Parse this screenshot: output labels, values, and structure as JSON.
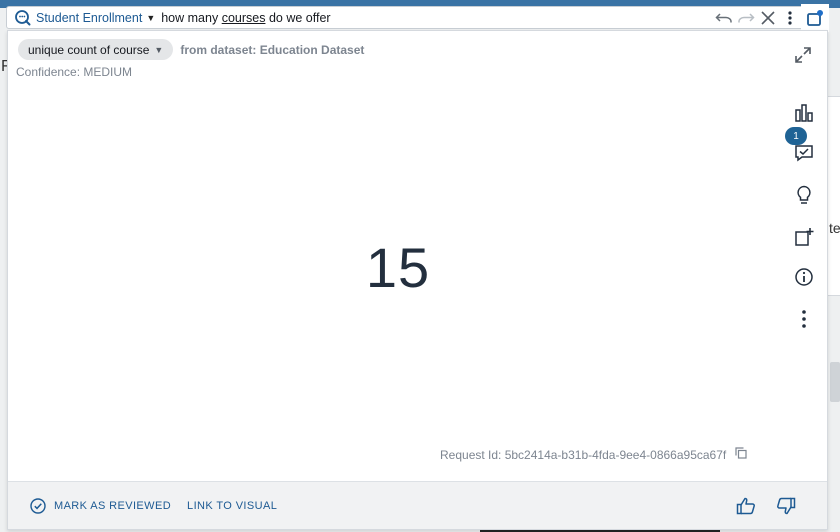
{
  "query_bar": {
    "topic": "Student Enrollment",
    "query_prefix": "how many ",
    "query_keyword": "courses",
    "query_suffix": " do we offer",
    "icons": [
      "q-topic-icon",
      "undo-icon",
      "redo-icon",
      "close-icon",
      "more-vertical-icon",
      "pin-icon"
    ]
  },
  "answer": {
    "interpretation_chip": "unique count of course",
    "from_dataset": "from dataset: Education Dataset",
    "confidence": "Confidence: MEDIUM",
    "value": "15",
    "request_id": "Request Id: 5bc2414a-b31b-4fda-9ee4-0866a95ca67f"
  },
  "side_tools": {
    "feedback_badge": "1",
    "icons": [
      "bar-chart-icon",
      "review-comment-icon",
      "lightbulb-icon",
      "add-to-analysis-icon",
      "info-icon",
      "more-vertical-icon"
    ]
  },
  "footer": {
    "mark_reviewed": "MARK AS REVIEWED",
    "link_visual": "LINK TO VISUAL"
  },
  "background": {
    "left_letter": "F",
    "right_text": "te"
  },
  "colors": {
    "accent": "#1d5a93",
    "topbar": "#3a73a5",
    "badge": "#1f6395",
    "kpi": "#232f3e"
  }
}
